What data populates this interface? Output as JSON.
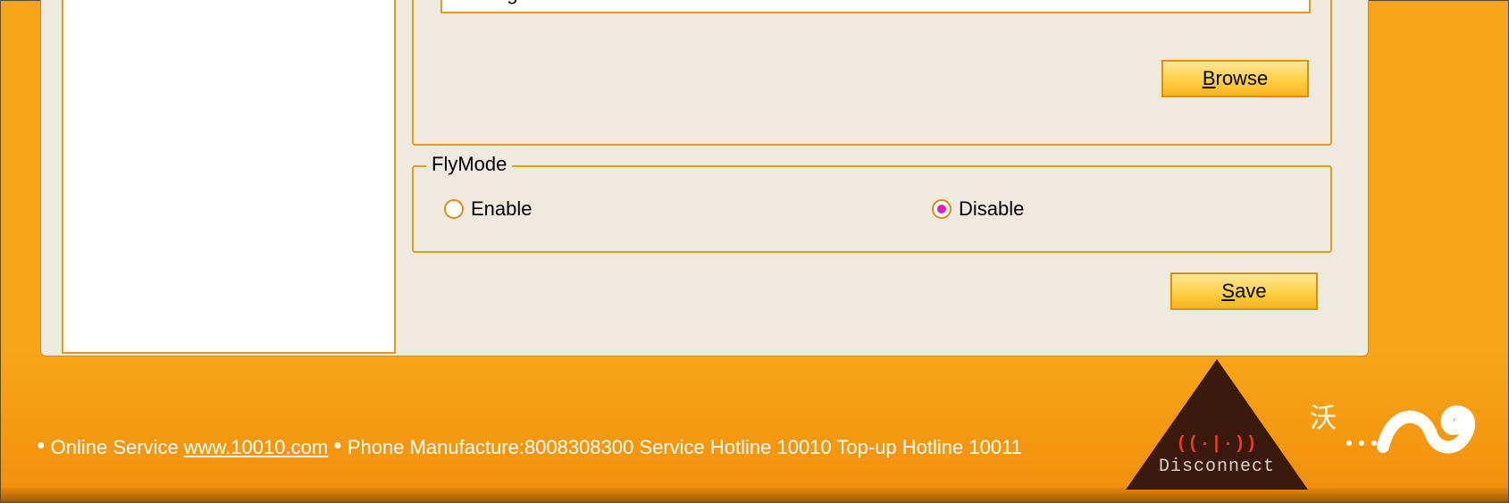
{
  "path": {
    "value": "C:\\Program Files\\Mobile Card\\userdata",
    "browse_label": "Browse",
    "browse_mnemonic": "B"
  },
  "flymode": {
    "legend": "FlyMode",
    "enable_label": "Enable",
    "disable_label": "Disable",
    "selected": "disable"
  },
  "save": {
    "label": "Save",
    "mnemonic": "S"
  },
  "footer": {
    "online_service_label": "Online Service",
    "online_service_link": "www.10010.com",
    "rest": "Phone Manufacture:8008308300 Service Hotline 10010 Top-up Hotline 10011"
  },
  "connection": {
    "status_label": "Disconnect",
    "signal_glyph": "((·|·))"
  },
  "logo": {
    "name": "wo-logo",
    "text": "沃"
  }
}
